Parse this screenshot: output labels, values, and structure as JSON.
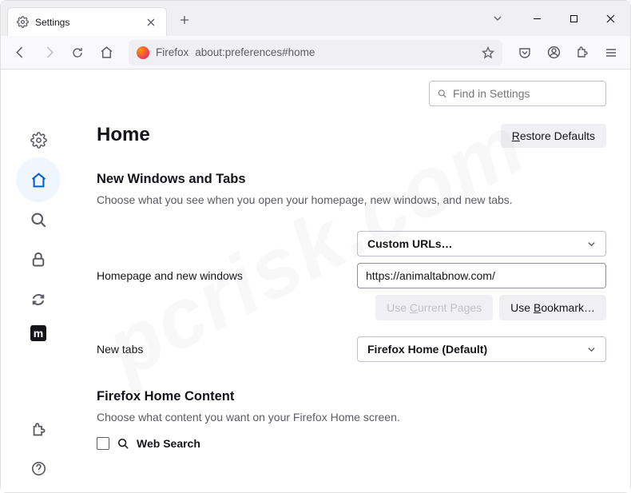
{
  "tab": {
    "title": "Settings"
  },
  "urlbar": {
    "label": "Firefox",
    "url": "about:preferences#home"
  },
  "settings_search": {
    "placeholder": "Find in Settings"
  },
  "page": {
    "title": "Home",
    "restore_label": "estore Defaults"
  },
  "section1": {
    "title": "New Windows and Tabs",
    "desc": "Choose what you see when you open your homepage, new windows, and new tabs.",
    "homepage_label": "Homepage and new windows",
    "homepage_select": "Custom URLs…",
    "homepage_url": "https://animaltabnow.com/",
    "use_current": "urrent Pages",
    "use_bookmark": "ookmark…",
    "newtabs_label": "New tabs",
    "newtabs_select": "Firefox Home (Default)"
  },
  "section2": {
    "title": "Firefox Home Content",
    "desc": "Choose what content you want on your Firefox Home screen.",
    "web_search": "Web Search"
  },
  "sidebar": {
    "m_label": "m"
  }
}
